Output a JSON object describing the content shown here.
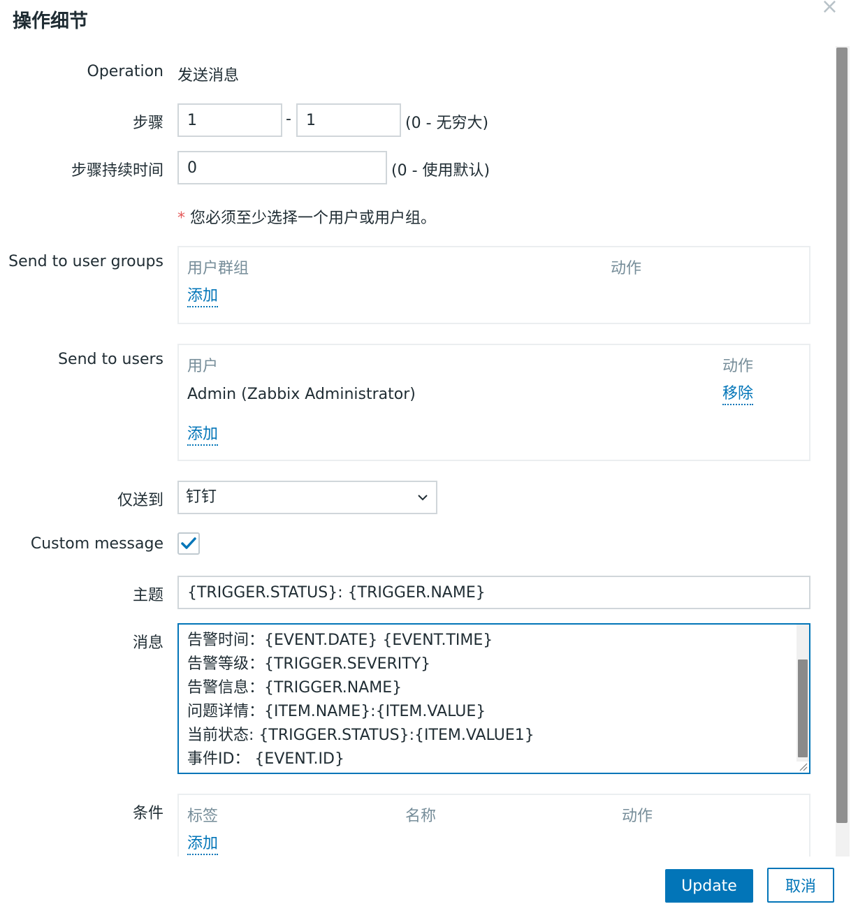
{
  "dialog": {
    "title": "操作细节",
    "close_label": "×"
  },
  "operation": {
    "label": "Operation",
    "value": "发送消息"
  },
  "steps": {
    "label": "步骤",
    "from": "1",
    "separator": "-",
    "to": "1",
    "hint": "(0 - 无穷大)"
  },
  "step_duration": {
    "label": "步骤持续时间",
    "value": "0",
    "hint": "(0 - 使用默认)"
  },
  "warning": {
    "asterisk": "*",
    "text": "您必须至少选择一个用户或用户组。"
  },
  "user_groups": {
    "label": "Send to user groups",
    "col_group": "用户群组",
    "col_action": "动作",
    "add": "添加"
  },
  "users": {
    "label": "Send to users",
    "col_user": "用户",
    "col_action": "动作",
    "rows": [
      {
        "name": "Admin (Zabbix Administrator)",
        "action": "移除"
      }
    ],
    "add": "添加"
  },
  "send_only_to": {
    "label": "仅送到",
    "selected": "钉钉"
  },
  "custom_message": {
    "label": "Custom message",
    "checked": true
  },
  "subject": {
    "label": "主题",
    "value": "{TRIGGER.STATUS}: {TRIGGER.NAME}"
  },
  "message": {
    "label": "消息",
    "lines": [
      "告警时间：{EVENT.DATE} {EVENT.TIME}",
      "告警等级：{TRIGGER.SEVERITY}",
      "告警信息：{TRIGGER.NAME}",
      "问题详情：{ITEM.NAME}:{ITEM.VALUE}",
      "当前状态: {TRIGGER.STATUS}:{ITEM.VALUE1}",
      "事件ID： {EVENT.ID}"
    ]
  },
  "conditions": {
    "label": "条件",
    "col_tag": "标签",
    "col_name": "名称",
    "col_action": "动作",
    "add": "添加"
  },
  "buttons": {
    "update": "Update",
    "cancel": "取消"
  },
  "colors": {
    "accent": "#0275b8",
    "required": "#e45959"
  }
}
